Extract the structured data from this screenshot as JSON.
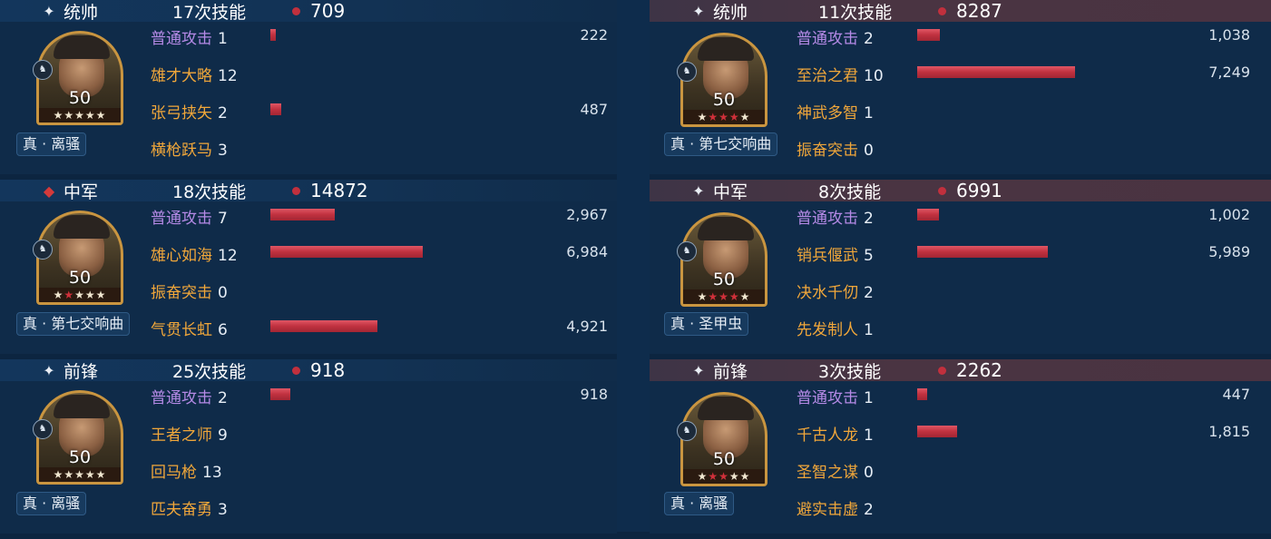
{
  "max_damage_scale": 8000,
  "left": [
    {
      "position_label": "统帅",
      "position_icon": "star-icon",
      "skill_count": "17次技能",
      "total_damage": "709",
      "level": "50",
      "stars": "★★★★★",
      "red_stars": 0,
      "skin": "真 · 离骚",
      "skills": [
        {
          "name": "普通攻击",
          "count": "1",
          "value": "222",
          "damage": 222,
          "basic": true
        },
        {
          "name": "雄才大略",
          "count": "12",
          "value": "",
          "damage": 0,
          "basic": false
        },
        {
          "name": "张弓挟矢",
          "count": "2",
          "value": "487",
          "damage": 487,
          "basic": false
        },
        {
          "name": "横枪跃马",
          "count": "3",
          "value": "",
          "damage": 0,
          "basic": false
        }
      ]
    },
    {
      "position_label": "中军",
      "position_icon": "flag-icon",
      "skill_count": "18次技能",
      "total_damage": "14872",
      "level": "50",
      "stars": "★★★★★",
      "red_stars": 1,
      "skin": "真 · 第七交响曲",
      "skills": [
        {
          "name": "普通攻击",
          "count": "7",
          "value": "2,967",
          "damage": 2967,
          "basic": true
        },
        {
          "name": "雄心如海",
          "count": "12",
          "value": "6,984",
          "damage": 6984,
          "basic": false
        },
        {
          "name": "振奋突击",
          "count": "0",
          "value": "",
          "damage": 0,
          "basic": false
        },
        {
          "name": "气贯长虹",
          "count": "6",
          "value": "4,921",
          "damage": 4921,
          "basic": false
        }
      ]
    },
    {
      "position_label": "前锋",
      "position_icon": "star-icon",
      "skill_count": "25次技能",
      "total_damage": "918",
      "level": "50",
      "stars": "★★★★★",
      "red_stars": 0,
      "skin": "真 · 离骚",
      "skills": [
        {
          "name": "普通攻击",
          "count": "2",
          "value": "918",
          "damage": 918,
          "basic": true
        },
        {
          "name": "王者之师",
          "count": "9",
          "value": "",
          "damage": 0,
          "basic": false
        },
        {
          "name": "回马枪",
          "count": "13",
          "value": "",
          "damage": 0,
          "basic": false
        },
        {
          "name": "匹夫奋勇",
          "count": "3",
          "value": "",
          "damage": 0,
          "basic": false
        }
      ]
    }
  ],
  "right": [
    {
      "position_label": "统帅",
      "position_icon": "star-icon",
      "skill_count": "11次技能",
      "total_damage": "8287",
      "level": "50",
      "stars": "★★★★★",
      "red_stars": 3,
      "skin": "真 · 第七交响曲",
      "skills": [
        {
          "name": "普通攻击",
          "count": "2",
          "value": "1,038",
          "damage": 1038,
          "basic": true
        },
        {
          "name": "至治之君",
          "count": "10",
          "value": "7,249",
          "damage": 7249,
          "basic": false
        },
        {
          "name": "神武多智",
          "count": "1",
          "value": "",
          "damage": 0,
          "basic": false
        },
        {
          "name": "振奋突击",
          "count": "0",
          "value": "",
          "damage": 0,
          "basic": false
        }
      ]
    },
    {
      "position_label": "中军",
      "position_icon": "star-icon",
      "skill_count": "8次技能",
      "total_damage": "6991",
      "level": "50",
      "stars": "★★★★★",
      "red_stars": 3,
      "skin": "真 · 圣甲虫",
      "skills": [
        {
          "name": "普通攻击",
          "count": "2",
          "value": "1,002",
          "damage": 1002,
          "basic": true
        },
        {
          "name": "销兵偃武",
          "count": "5",
          "value": "5,989",
          "damage": 5989,
          "basic": false
        },
        {
          "name": "决水千仞",
          "count": "2",
          "value": "",
          "damage": 0,
          "basic": false
        },
        {
          "name": "先发制人",
          "count": "1",
          "value": "",
          "damage": 0,
          "basic": false
        }
      ]
    },
    {
      "position_label": "前锋",
      "position_icon": "star-icon",
      "skill_count": "3次技能",
      "total_damage": "2262",
      "level": "50",
      "stars": "★★★★★",
      "red_stars": 2,
      "skin": "真 · 离骚",
      "skills": [
        {
          "name": "普通攻击",
          "count": "1",
          "value": "447",
          "damage": 447,
          "basic": true
        },
        {
          "name": "千古人龙",
          "count": "1",
          "value": "1,815",
          "damage": 1815,
          "basic": false
        },
        {
          "name": "圣智之谋",
          "count": "0",
          "value": "",
          "damage": 0,
          "basic": false
        },
        {
          "name": "避实击虚",
          "count": "2",
          "value": "",
          "damage": 0,
          "basic": false
        }
      ]
    }
  ]
}
